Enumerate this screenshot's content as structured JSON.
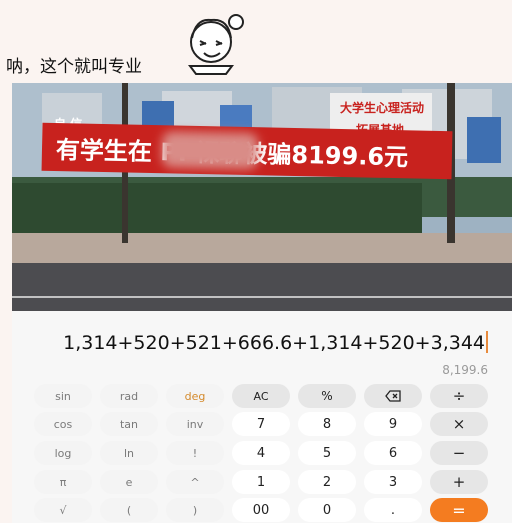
{
  "caption": "呐，这个就叫专业",
  "photo": {
    "banner_text": "有学生在          PP裸聊被骗8199.6元",
    "sign_left": "自     信",
    "sign_right_top": "大学生心理活动",
    "sign_right_bottom": "拓展基地"
  },
  "calculator": {
    "expression": "1,314+520+521+666.6+1,314+520+3,344",
    "result": "8,199.6",
    "accent_color": "#f47c20",
    "keys": [
      [
        "sin",
        "rad",
        "deg",
        "AC",
        "%",
        "backspace-icon",
        "÷"
      ],
      [
        "cos",
        "tan",
        "inv",
        "7",
        "8",
        "9",
        "×"
      ],
      [
        "log",
        "ln",
        "!",
        "4",
        "5",
        "6",
        "−"
      ],
      [
        "π",
        "e",
        "^",
        "1",
        "2",
        "3",
        "+"
      ],
      [
        "√",
        "(",
        ")",
        "00",
        "0",
        ".",
        "="
      ]
    ],
    "labels": {
      "sin": "sin",
      "rad": "rad",
      "deg": "deg",
      "ac": "AC",
      "percent": "%",
      "divide": "÷",
      "cos": "cos",
      "tan": "tan",
      "inv": "inv",
      "seven": "7",
      "eight": "8",
      "nine": "9",
      "multiply": "×",
      "log": "log",
      "ln": "ln",
      "factorial": "!",
      "four": "4",
      "five": "5",
      "six": "6",
      "minus": "−",
      "pi": "π",
      "e": "e",
      "power": "^",
      "one": "1",
      "two": "2",
      "three": "3",
      "plus": "+",
      "sqrt": "√",
      "lparen": "(",
      "rparen": ")",
      "double_zero": "00",
      "zero": "0",
      "dot": ".",
      "equals": "="
    }
  }
}
